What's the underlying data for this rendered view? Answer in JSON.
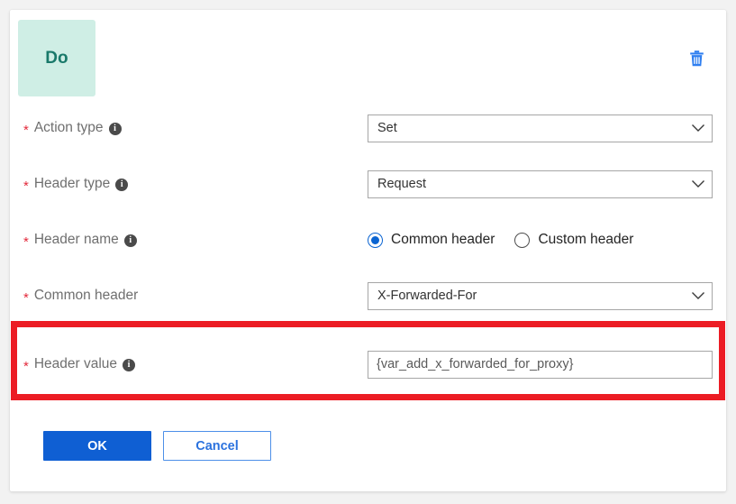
{
  "card": {
    "badge_label": "Do",
    "delete_icon": "trash-icon"
  },
  "form": {
    "rows": [
      {
        "label": "Action type",
        "required_marker": "*",
        "has_info_icon": true,
        "info_glyph": "i",
        "control": "dropdown",
        "value": "Set"
      },
      {
        "label": "Header type",
        "required_marker": "*",
        "has_info_icon": true,
        "info_glyph": "i",
        "control": "dropdown",
        "value": "Request"
      },
      {
        "label": "Header name",
        "required_marker": "*",
        "has_info_icon": true,
        "info_glyph": "i",
        "control": "radio",
        "options": [
          {
            "label": "Common header",
            "selected": true
          },
          {
            "label": "Custom header",
            "selected": false
          }
        ]
      },
      {
        "label": "Common header",
        "required_marker": "*",
        "has_info_icon": false,
        "control": "dropdown",
        "value": "X-Forwarded-For"
      },
      {
        "label": "Header value",
        "required_marker": "*",
        "has_info_icon": true,
        "info_glyph": "i",
        "control": "textinput",
        "value": "{var_add_x_forwarded_for_proxy}",
        "placeholder": ""
      }
    ]
  },
  "buttons": {
    "ok_label": "OK",
    "cancel_label": "Cancel"
  },
  "colors": {
    "badge_background": "#cfeee5",
    "badge_text": "#19796a",
    "required_star": "#e3293b",
    "primary_button": "#0f5fd3",
    "secondary_button_text": "#2b72de",
    "annotation_border": "#ec1c24",
    "radio_selected": "#0a64d2",
    "delete_icon": "#2f7ff0",
    "page_background": "#f2f2f2",
    "card_background": "#ffffff"
  }
}
